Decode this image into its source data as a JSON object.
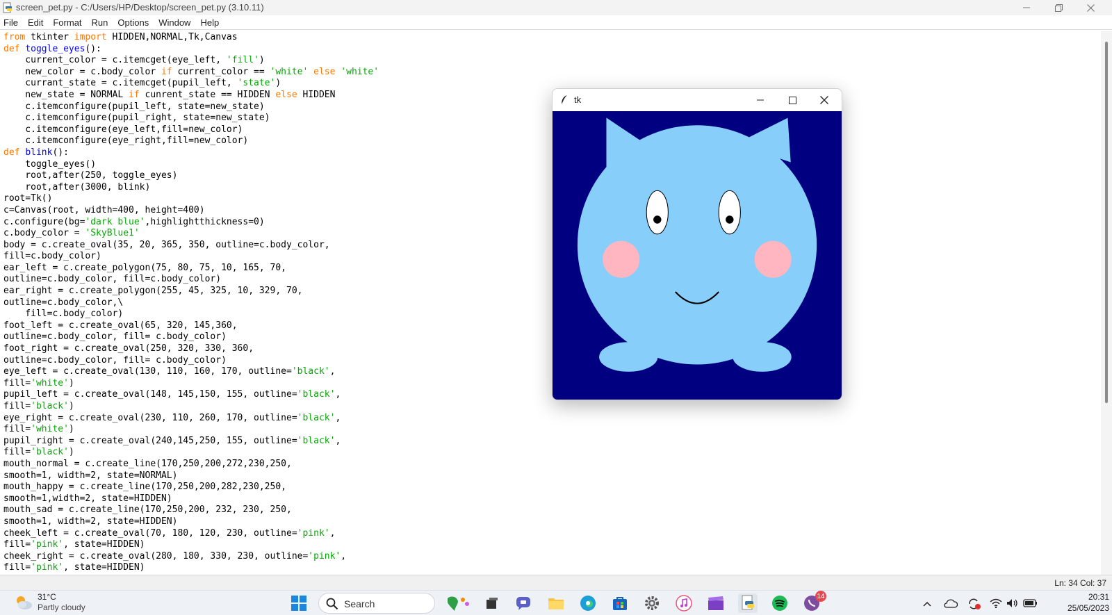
{
  "window": {
    "title": "screen_pet.py - C:/Users/HP/Desktop/screen_pet.py (3.10.11)"
  },
  "menu": [
    "File",
    "Edit",
    "Format",
    "Run",
    "Options",
    "Window",
    "Help"
  ],
  "code_lines": [
    [
      [
        "kw",
        "from"
      ],
      [
        "t",
        " tkinter "
      ],
      [
        "kw",
        "import"
      ],
      [
        "t",
        " HIDDEN,NORMAL,Tk,Canvas"
      ]
    ],
    [
      [
        "kw",
        "def"
      ],
      [
        "t",
        " "
      ],
      [
        "def",
        "toggle_eyes"
      ],
      [
        "t",
        "():"
      ]
    ],
    [
      [
        "t",
        "    current_color = c.itemcget(eye_left, "
      ],
      [
        "str",
        "'fill'"
      ],
      [
        "t",
        ")"
      ]
    ],
    [
      [
        "t",
        "    new_color = c.body_color "
      ],
      [
        "kw",
        "if"
      ],
      [
        "t",
        " current_color == "
      ],
      [
        "str",
        "'white'"
      ],
      [
        "t",
        " "
      ],
      [
        "kw",
        "else"
      ],
      [
        "t",
        " "
      ],
      [
        "str",
        "'white'"
      ]
    ],
    [
      [
        "t",
        "    currant_state = c.itemcget(pupil_left, "
      ],
      [
        "str",
        "'state'"
      ],
      [
        "t",
        ")"
      ]
    ],
    [
      [
        "t",
        "    new_state = NORMAL "
      ],
      [
        "kw",
        "if"
      ],
      [
        "t",
        " cunrent_state == HIDDEN "
      ],
      [
        "kw",
        "else"
      ],
      [
        "t",
        " HIDDEN"
      ]
    ],
    [
      [
        "t",
        "    c.itemconfigure(pupil_left, state=new_state)"
      ]
    ],
    [
      [
        "t",
        "    c.itemconfigure(pupil_right, state=new_state)"
      ]
    ],
    [
      [
        "t",
        "    c.itemconfigure(eye_left,fill=new_color)"
      ]
    ],
    [
      [
        "t",
        "    c.itemconfigure(eye_right,fill=new_color)"
      ]
    ],
    [
      [
        "kw",
        "def"
      ],
      [
        "t",
        " "
      ],
      [
        "def",
        "blink"
      ],
      [
        "t",
        "():"
      ]
    ],
    [
      [
        "t",
        "    toggle_eyes()"
      ]
    ],
    [
      [
        "t",
        "    root,after(250, toggle_eyes)"
      ]
    ],
    [
      [
        "t",
        "    root,after(3000, blink)"
      ]
    ],
    [
      [
        "t",
        "root=Tk()"
      ]
    ],
    [
      [
        "t",
        "c=Canvas(root, width=400, height=400)"
      ]
    ],
    [
      [
        "t",
        "c.configure(bg="
      ],
      [
        "str",
        "'dark blue'"
      ],
      [
        "t",
        ",highlightthickness=0)"
      ]
    ],
    [
      [
        "t",
        "c.body_color = "
      ],
      [
        "str",
        "'SkyBlue1'"
      ]
    ],
    [
      [
        "t",
        "body = c.create_oval(35, 20, 365, 350, outline=c.body_color,"
      ]
    ],
    [
      [
        "t",
        "fill=c.body_color)"
      ]
    ],
    [
      [
        "t",
        "ear_left = c.create_polygon(75, 80, 75, 10, 165, 70,"
      ]
    ],
    [
      [
        "t",
        "outline=c.body_color, fill=c.body_color)"
      ]
    ],
    [
      [
        "t",
        "ear_right = c.create_polygon(255, 45, 325, 10, 329, 70,"
      ]
    ],
    [
      [
        "t",
        "outline=c.body_color,\\"
      ]
    ],
    [
      [
        "t",
        "    fill=c.body_color)"
      ]
    ],
    [
      [
        "t",
        "foot_left = c.create_oval(65, 320, 145,360,"
      ]
    ],
    [
      [
        "t",
        "outline=c.body_color, fill= c.body_color)"
      ]
    ],
    [
      [
        "t",
        "foot_right = c.create_oval(250, 320, 330, 360,"
      ]
    ],
    [
      [
        "t",
        "outline=c.body_color, fill= c.body_color)"
      ]
    ],
    [
      [
        "t",
        "eye_left = c.create_oval(130, 110, 160, 170, outline="
      ],
      [
        "str",
        "'black'"
      ],
      [
        "t",
        ","
      ]
    ],
    [
      [
        "t",
        "fill="
      ],
      [
        "str",
        "'white'"
      ],
      [
        "t",
        ")"
      ]
    ],
    [
      [
        "t",
        "pupil_left = c.create_oval(148, 145,150, 155, outline="
      ],
      [
        "str",
        "'black'"
      ],
      [
        "t",
        ","
      ]
    ],
    [
      [
        "t",
        "fill="
      ],
      [
        "str",
        "'black'"
      ],
      [
        "t",
        ")"
      ]
    ],
    [
      [
        "t",
        "eye_right = c.create_oval(230, 110, 260, 170, outline="
      ],
      [
        "str",
        "'black'"
      ],
      [
        "t",
        ","
      ]
    ],
    [
      [
        "t",
        "fill="
      ],
      [
        "str",
        "'white'"
      ],
      [
        "t",
        ")"
      ]
    ],
    [
      [
        "t",
        "pupil_right = c.create_oval(240,145,250, 155, outline="
      ],
      [
        "str",
        "'black'"
      ],
      [
        "t",
        ","
      ]
    ],
    [
      [
        "t",
        "fill="
      ],
      [
        "str",
        "'black'"
      ],
      [
        "t",
        ")"
      ]
    ],
    [
      [
        "t",
        "mouth_normal = c.create_line(170,250,200,272,230,250,"
      ]
    ],
    [
      [
        "t",
        "smooth=1, width=2, state=NORMAL)"
      ]
    ],
    [
      [
        "t",
        "mouth_happy = c.create_line(170,250,200,282,230,250,"
      ]
    ],
    [
      [
        "t",
        "smooth=1,width=2, state=HIDDEN)"
      ]
    ],
    [
      [
        "t",
        "mouth_sad = c.create_line(170,250,200, 232, 230, 250,"
      ]
    ],
    [
      [
        "t",
        "smooth=1, width=2, state=HIDDEN)"
      ]
    ],
    [
      [
        "t",
        "cheek_left = c.create_oval(70, 180, 120, 230, outline="
      ],
      [
        "str",
        "'pink'"
      ],
      [
        "t",
        ","
      ]
    ],
    [
      [
        "t",
        "fill="
      ],
      [
        "str",
        "'pink'"
      ],
      [
        "t",
        ", state=HIDDEN)"
      ]
    ],
    [
      [
        "t",
        "cheek_right = c.create_oval(280, 180, 330, 230, outline="
      ],
      [
        "str",
        "'pink'"
      ],
      [
        "t",
        ","
      ]
    ],
    [
      [
        "t",
        "fill="
      ],
      [
        "str",
        "'pink'"
      ],
      [
        "t",
        ", state=HIDDEN)"
      ]
    ]
  ],
  "status": {
    "position": "Ln: 34   Col: 37"
  },
  "tk_window": {
    "title": "tk",
    "colors": {
      "background": "#000080",
      "body": "#87cefa",
      "cheek": "#ffb6c1",
      "eye": "#ffffff",
      "outline": "#000000"
    }
  },
  "taskbar": {
    "weather_temp": "31°C",
    "weather_desc": "Partly cloudy",
    "search_label": "Search",
    "notification_count": "14",
    "clock_time": "20:31",
    "clock_date": "25/05/2023"
  }
}
